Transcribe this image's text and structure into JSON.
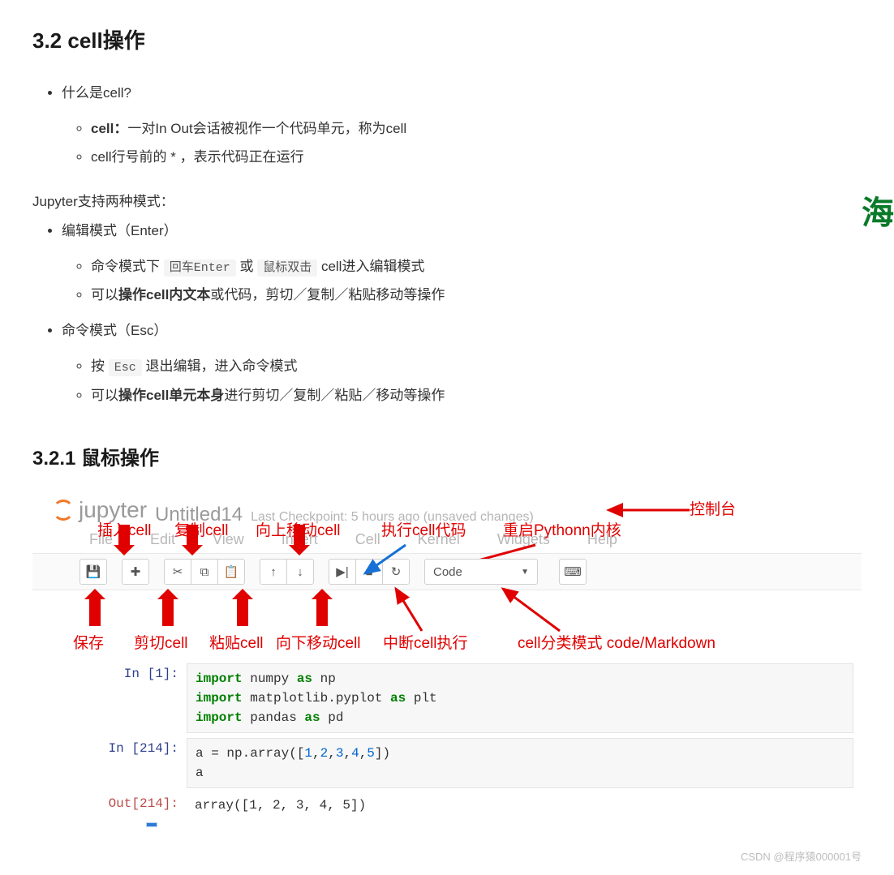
{
  "section": {
    "title": "3.2 cell操作",
    "bullet_q": "什么是cell?",
    "bullet_def": "一对In Out会话被视作一个代码单元，称为cell",
    "bullet_def_prefix": "cell：",
    "bullet_star": "cell行号前的 * ，表示代码正在运行",
    "modes_intro": "Jupyter支持两种模式：",
    "edit_mode_title": "编辑模式（Enter）",
    "edit_sub1_pre": "命令模式下 ",
    "edit_sub1_code1": "回车Enter",
    "edit_sub1_mid": " 或 ",
    "edit_sub1_code2": "鼠标双击",
    "edit_sub1_post": " cell进入编辑模式",
    "edit_sub2": "可以操作cell内文本或代码，剪切／复制／粘贴移动等操作",
    "edit_sub2_bold": "操作cell内文本",
    "cmd_mode_title": "命令模式（Esc）",
    "cmd_sub1_pre": "按 ",
    "cmd_sub1_code": "Esc",
    "cmd_sub1_post": " 退出编辑，进入命令模式",
    "cmd_sub2_pre": "可以",
    "cmd_sub2_bold": "操作cell单元本身",
    "cmd_sub2_post": "进行剪切／复制／粘贴／移动等操作",
    "subsection_title": "3.2.1 鼠标操作"
  },
  "jupyter": {
    "brand": "jupyter",
    "title": "Untitled14",
    "checkpoint": "Last Checkpoint: 5 hours ago (unsaved changes)",
    "menus": [
      "File",
      "Edit",
      "View",
      "Insert",
      "Cell",
      "Kernel",
      "Widgets",
      "Help"
    ],
    "select_value": "Code",
    "toolbar_icons": {
      "save": "💾",
      "add": "✚",
      "cut": "✂",
      "copy": "⧉",
      "paste": "📋",
      "up": "↑",
      "down": "↓",
      "run": "▶|",
      "stop": "■",
      "restart": "↻",
      "console": "⌨"
    }
  },
  "annotations": {
    "top": {
      "insert": "插入cell",
      "copy": "复制cell",
      "move_up": "向上移动cell",
      "run": "执行cell代码",
      "restart": "重启Pythonn内核"
    },
    "right": {
      "console": "控制台"
    },
    "bottom": {
      "save": "保存",
      "cut": "剪切cell",
      "paste": "粘贴cell",
      "move_down": "向下移动cell",
      "interrupt": "中断cell执行",
      "celltype": "cell分类模式 code/Markdown"
    }
  },
  "cells": [
    {
      "prompt": "In  [1]:",
      "code_lines": [
        {
          "pre": "import",
          "mid": " numpy ",
          "kw": "as",
          "post": " np"
        },
        {
          "pre": "import",
          "mid": " matplotlib.pyplot ",
          "kw": "as",
          "post": " plt"
        },
        {
          "pre": "import",
          "mid": " pandas ",
          "kw": "as",
          "post": " pd"
        }
      ]
    },
    {
      "prompt": "In  [214]:",
      "code_text": "a = np.array([1,2,3,4,5])\na"
    },
    {
      "prompt": "Out[214]:",
      "output": "array([1, 2, 3, 4, 5])"
    }
  ],
  "watermarks": {
    "right": "海",
    "bottom": "CSDN @程序猿000001号"
  },
  "colors": {
    "annotation_red": "#e00000",
    "annotation_blue": "#1670d6"
  }
}
